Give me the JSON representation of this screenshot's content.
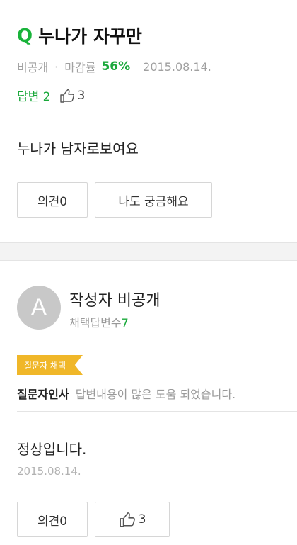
{
  "question": {
    "q_mark": "Q",
    "title": "누나가 자꾸만",
    "visibility": "비공개",
    "separator": "·",
    "deadline_label": "마감률",
    "deadline_rate": "56%",
    "date": "2015.08.14.",
    "answers_label": "답변 2",
    "likes": "3",
    "body": "누나가 남자로보여요",
    "opinion_button": "의견0",
    "me_too_button": "나도 궁금해요"
  },
  "answer": {
    "avatar_letter": "A",
    "author": "작성자 비공개",
    "adopt_label": "채택답변수",
    "adopt_count": "7",
    "badge": "질문자 채택",
    "thanks_who": "질문자인사",
    "thanks_msg": "답변내용이 많은 도움 되었습니다.",
    "body": "정상입니다.",
    "date": "2015.08.14.",
    "opinion_button": "의견0",
    "likes": "3"
  },
  "colors": {
    "accent_green": "#19a83a",
    "badge_yellow": "#f0b729"
  },
  "icons": {
    "like": "thumbs-up-icon"
  }
}
